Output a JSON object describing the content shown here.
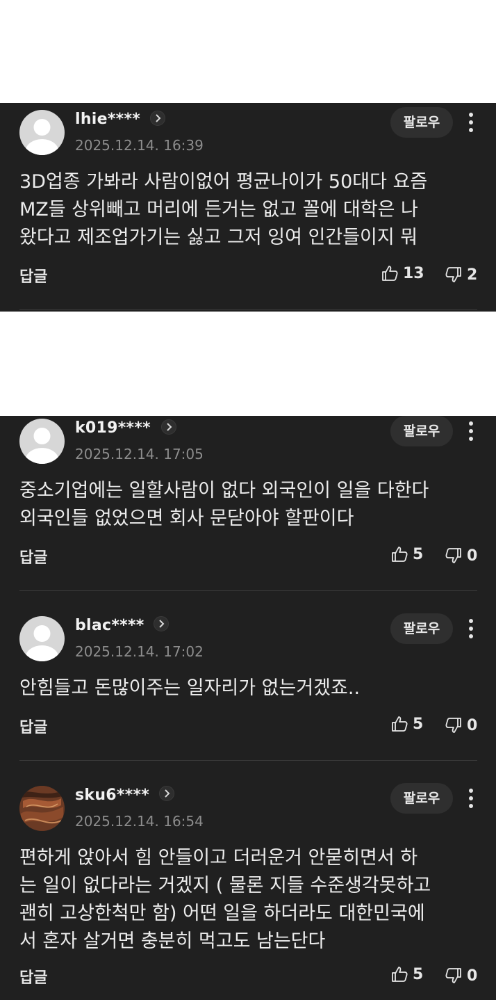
{
  "ui": {
    "follow_label": "팔로우",
    "reply_label": "답글"
  },
  "comments": [
    {
      "username": "lhie****",
      "date": "2025.12.14. 16:39",
      "body": "3D업종 가봐라 사람이없어 평균나이가 50대다 요즘\nMZ들 상위빼고 머리에 든거는 없고 꼴에 대학은 나\n왔다고 제조업가기는 싫고 그저 잉여 인간들이지 뭐",
      "likes": "13",
      "dislikes": "2"
    },
    {
      "username": "k019****",
      "date": "2025.12.14. 17:05",
      "body": "중소기업에는 일할사람이 없다 외국인이 일을 다한다\n외국인들 없었으면 회사 문닫아야 할판이다",
      "likes": "5",
      "dislikes": "0"
    },
    {
      "username": "blac****",
      "date": "2025.12.14. 17:02",
      "body": "안힘들고 돈많이주는 일자리가 없는거겠죠..",
      "likes": "5",
      "dislikes": "0"
    },
    {
      "username": "sku6****",
      "date": "2025.12.14. 16:54",
      "body": "편하게 앉아서 힘 안들이고 더러운거 안묻히면서 하\n는 일이 없다라는 거겠지 ( 물론 지들 수준생각못하고\n괜히 고상한척만 함) 어떤 일을 하더라도 대한민국에\n서 혼자 살거면 충분히 먹고도 남는단다",
      "likes": "5",
      "dislikes": "0"
    }
  ],
  "icons": {
    "avatar_default": "default-user-avatar",
    "avatar_photo": "food-photo-avatar",
    "chevron": "chevron-right-icon",
    "more": "more-vertical-icon",
    "like": "thumb-up-icon",
    "dislike": "thumb-down-icon"
  },
  "colors": {
    "background": "#202020",
    "text": "#ececec",
    "meta": "#8d8d8d"
  }
}
